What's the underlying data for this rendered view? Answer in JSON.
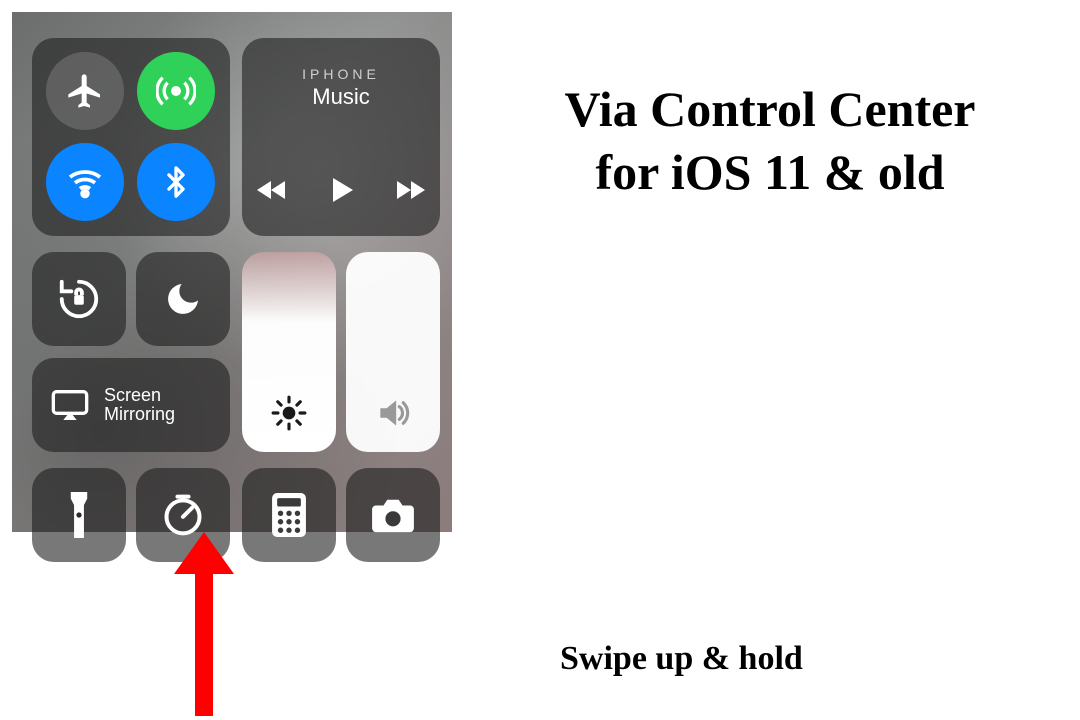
{
  "headline_line1": "Via Control Center",
  "headline_line2": "for iOS 11 & old",
  "caption": "Swipe up & hold",
  "music": {
    "sub": "IPHONE",
    "main": "Music"
  },
  "mirror": {
    "line1": "Screen",
    "line2": "Mirroring"
  },
  "icons": {
    "airplane": "airplane-icon",
    "cellular": "cellular-icon",
    "wifi": "wifi-icon",
    "bluetooth": "bluetooth-icon",
    "lock": "orientation-lock-icon",
    "dnd": "moon-icon",
    "brightness": "sun-icon",
    "volume": "speaker-icon",
    "mirror": "airplay-icon",
    "flashlight": "flashlight-icon",
    "timer": "timer-icon",
    "calculator": "calculator-icon",
    "camera": "camera-icon",
    "prev": "previous-track-icon",
    "play": "play-icon",
    "next": "next-track-icon"
  },
  "states": {
    "airplane_on": false,
    "cellular_on": true,
    "wifi_on": true,
    "bluetooth_on": true
  },
  "colors": {
    "active_green": "#30d158",
    "active_blue": "#0a84ff",
    "arrow": "#ff0000"
  }
}
